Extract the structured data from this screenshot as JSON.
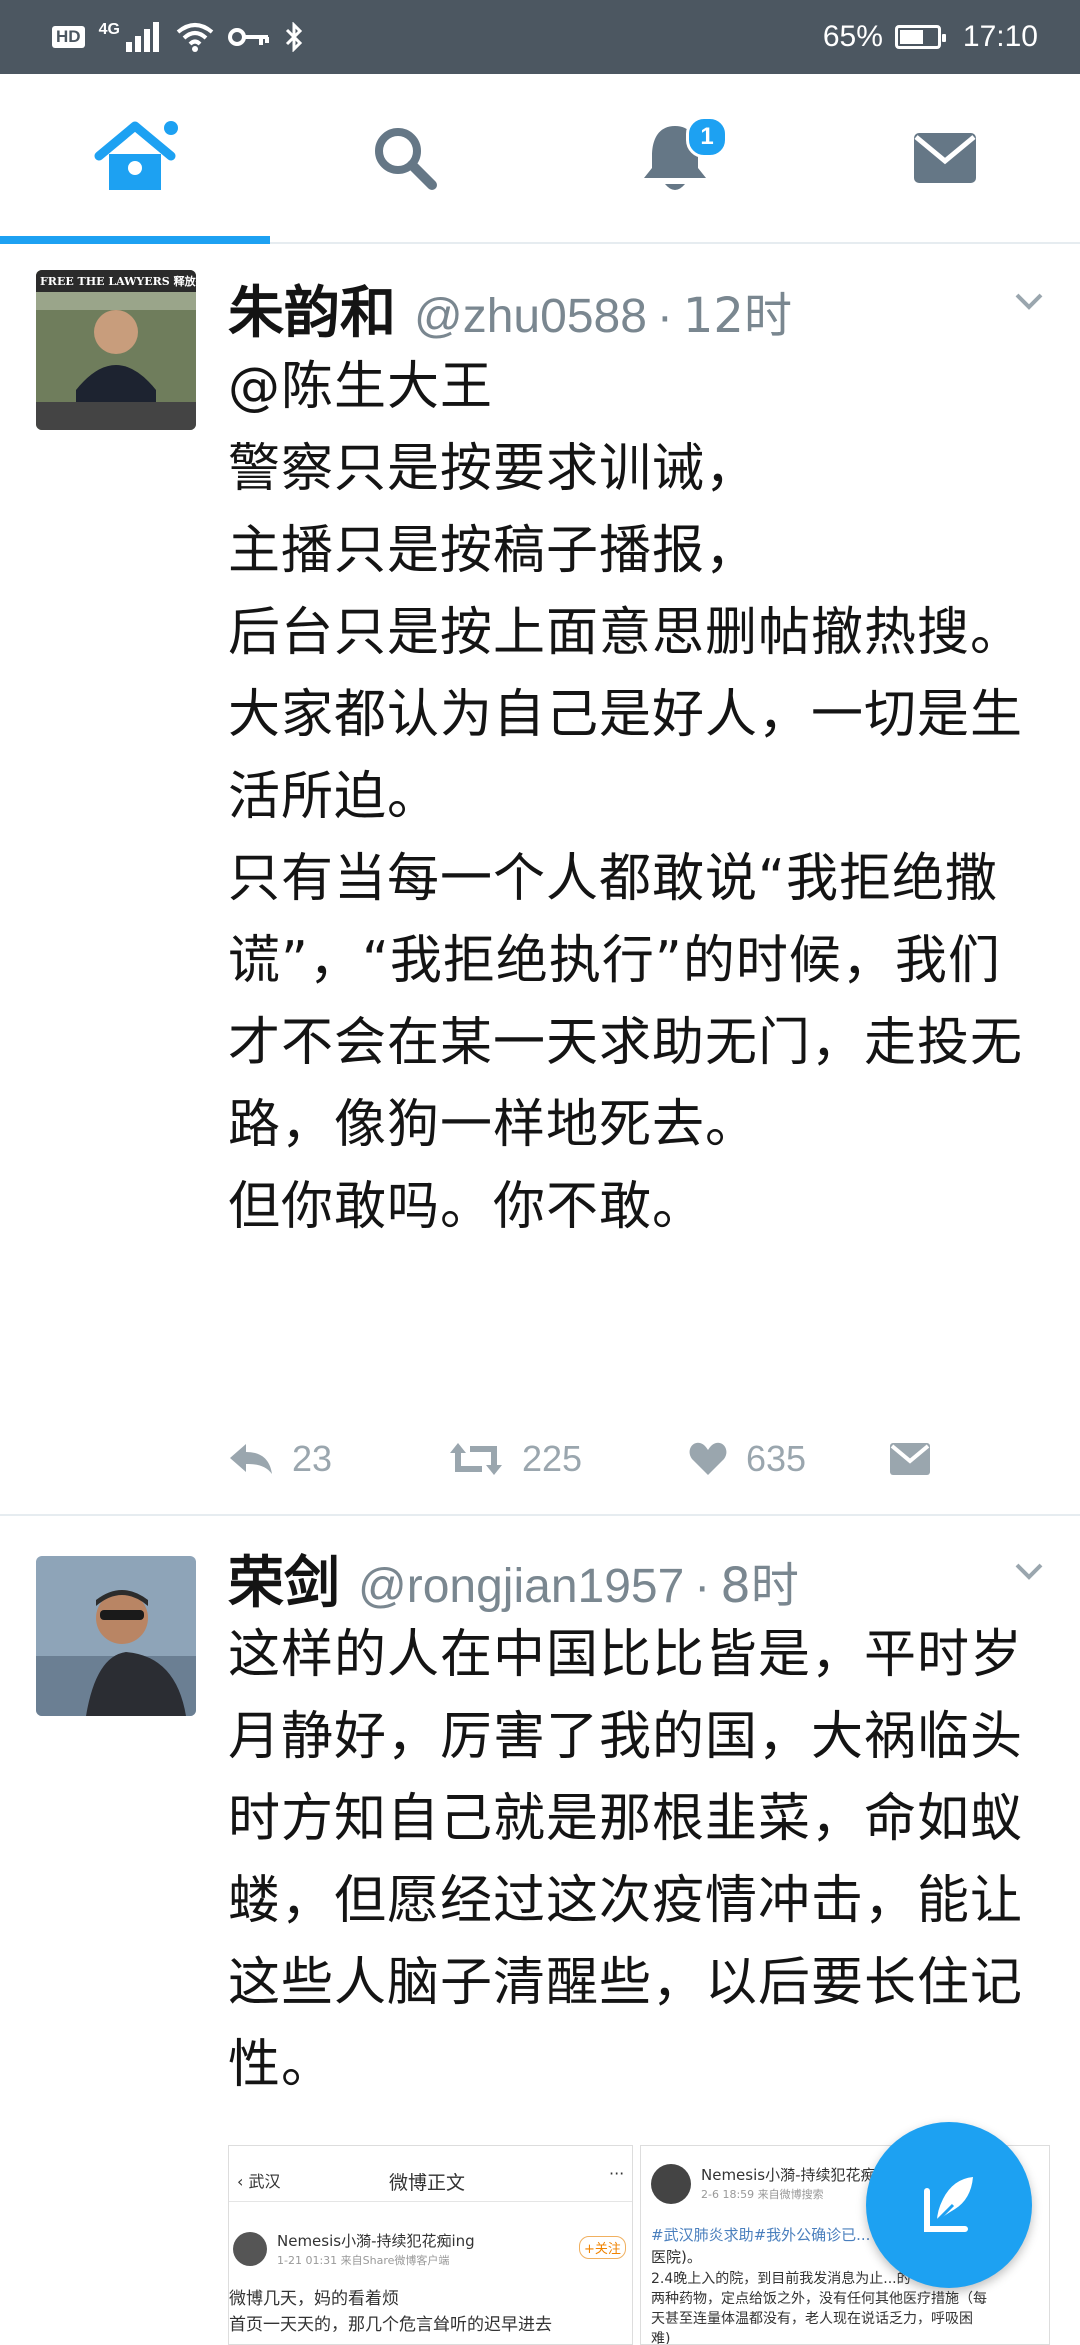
{
  "status_bar": {
    "hd": "HD",
    "network": "4G",
    "battery": "65%",
    "battery_level": 0.65,
    "time": "17:10"
  },
  "tabs": [
    {
      "icon": "home-icon",
      "active": true
    },
    {
      "icon": "search-icon"
    },
    {
      "icon": "notifications-icon",
      "badge": "1"
    },
    {
      "icon": "messages-icon"
    }
  ],
  "tweets": [
    {
      "display_name": "朱韵和",
      "handle": "@zhu0588",
      "time": "12时",
      "avatar_text": "FREE THE LAWYERS 释放律师",
      "lines": [
        "@陈生大王",
        "警察只是按要求训诫，",
        "主播只是按稿子播报，",
        "后台只是按上面意思删帖撤热搜。",
        "大家都认为自己是好人，一切是生活所迫。",
        "只有当每一个人都敢说“我拒绝撒谎”，“我拒绝执行”的时候，我们才不会在某一天求助无门，走投无路，像狗一样地死去。",
        "但你敢吗。你不敢。"
      ],
      "replies": "23",
      "retweets": "225",
      "likes": "635"
    },
    {
      "display_name": "荣剑",
      "handle": "@rongjian1957",
      "time": "8时",
      "lines": [
        "这样的人在中国比比皆是，平时岁月静好，厉害了我的国，大祸临头时方知自己就是那根韭菜，命如蚁蝼，但愿经过这次疫情冲击，能让这些人脑子清醒些，以后要长住记性。"
      ]
    }
  ],
  "media": {
    "left": {
      "back": "武汉",
      "title": "微博正文",
      "user": "Nemesis小漪-持续犯花痴ing",
      "meta": "1-21 01:31 来自Share微博客户端",
      "follow": "+关注",
      "line1": "微博几天，妈的看着烦",
      "line2": "首页一天天的，那几个危言耸听的迟早进去"
    },
    "right": {
      "user": "Nemesis小漪-持续犯花痴",
      "meta": "2-6 18:59 来自微博搜索",
      "line1": "#武汉肺炎求助#我外公确诊已...",
      "line2": "医院)。",
      "line3": "2.4晚上入的院，到目前我发消息为止...的",
      "line4": "两种药物，定点给饭之外，没有任何其他医疗措施（每",
      "line5": "天甚至连量体温都没有，老人现在说话乏力，呼吸困",
      "line6": "难)"
    }
  }
}
